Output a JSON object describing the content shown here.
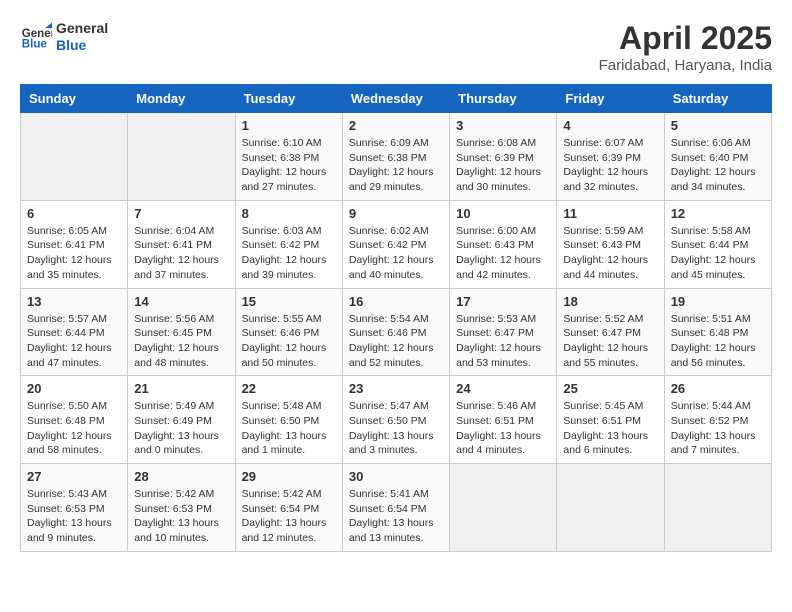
{
  "logo": {
    "line1": "General",
    "line2": "Blue"
  },
  "title": "April 2025",
  "subtitle": "Faridabad, Haryana, India",
  "days_of_week": [
    "Sunday",
    "Monday",
    "Tuesday",
    "Wednesday",
    "Thursday",
    "Friday",
    "Saturday"
  ],
  "weeks": [
    [
      {
        "day": "",
        "info": ""
      },
      {
        "day": "",
        "info": ""
      },
      {
        "day": "1",
        "info": "Sunrise: 6:10 AM\nSunset: 6:38 PM\nDaylight: 12 hours and 27 minutes."
      },
      {
        "day": "2",
        "info": "Sunrise: 6:09 AM\nSunset: 6:38 PM\nDaylight: 12 hours and 29 minutes."
      },
      {
        "day": "3",
        "info": "Sunrise: 6:08 AM\nSunset: 6:39 PM\nDaylight: 12 hours and 30 minutes."
      },
      {
        "day": "4",
        "info": "Sunrise: 6:07 AM\nSunset: 6:39 PM\nDaylight: 12 hours and 32 minutes."
      },
      {
        "day": "5",
        "info": "Sunrise: 6:06 AM\nSunset: 6:40 PM\nDaylight: 12 hours and 34 minutes."
      }
    ],
    [
      {
        "day": "6",
        "info": "Sunrise: 6:05 AM\nSunset: 6:41 PM\nDaylight: 12 hours and 35 minutes."
      },
      {
        "day": "7",
        "info": "Sunrise: 6:04 AM\nSunset: 6:41 PM\nDaylight: 12 hours and 37 minutes."
      },
      {
        "day": "8",
        "info": "Sunrise: 6:03 AM\nSunset: 6:42 PM\nDaylight: 12 hours and 39 minutes."
      },
      {
        "day": "9",
        "info": "Sunrise: 6:02 AM\nSunset: 6:42 PM\nDaylight: 12 hours and 40 minutes."
      },
      {
        "day": "10",
        "info": "Sunrise: 6:00 AM\nSunset: 6:43 PM\nDaylight: 12 hours and 42 minutes."
      },
      {
        "day": "11",
        "info": "Sunrise: 5:59 AM\nSunset: 6:43 PM\nDaylight: 12 hours and 44 minutes."
      },
      {
        "day": "12",
        "info": "Sunrise: 5:58 AM\nSunset: 6:44 PM\nDaylight: 12 hours and 45 minutes."
      }
    ],
    [
      {
        "day": "13",
        "info": "Sunrise: 5:57 AM\nSunset: 6:44 PM\nDaylight: 12 hours and 47 minutes."
      },
      {
        "day": "14",
        "info": "Sunrise: 5:56 AM\nSunset: 6:45 PM\nDaylight: 12 hours and 48 minutes."
      },
      {
        "day": "15",
        "info": "Sunrise: 5:55 AM\nSunset: 6:46 PM\nDaylight: 12 hours and 50 minutes."
      },
      {
        "day": "16",
        "info": "Sunrise: 5:54 AM\nSunset: 6:46 PM\nDaylight: 12 hours and 52 minutes."
      },
      {
        "day": "17",
        "info": "Sunrise: 5:53 AM\nSunset: 6:47 PM\nDaylight: 12 hours and 53 minutes."
      },
      {
        "day": "18",
        "info": "Sunrise: 5:52 AM\nSunset: 6:47 PM\nDaylight: 12 hours and 55 minutes."
      },
      {
        "day": "19",
        "info": "Sunrise: 5:51 AM\nSunset: 6:48 PM\nDaylight: 12 hours and 56 minutes."
      }
    ],
    [
      {
        "day": "20",
        "info": "Sunrise: 5:50 AM\nSunset: 6:48 PM\nDaylight: 12 hours and 58 minutes."
      },
      {
        "day": "21",
        "info": "Sunrise: 5:49 AM\nSunset: 6:49 PM\nDaylight: 13 hours and 0 minutes."
      },
      {
        "day": "22",
        "info": "Sunrise: 5:48 AM\nSunset: 6:50 PM\nDaylight: 13 hours and 1 minute."
      },
      {
        "day": "23",
        "info": "Sunrise: 5:47 AM\nSunset: 6:50 PM\nDaylight: 13 hours and 3 minutes."
      },
      {
        "day": "24",
        "info": "Sunrise: 5:46 AM\nSunset: 6:51 PM\nDaylight: 13 hours and 4 minutes."
      },
      {
        "day": "25",
        "info": "Sunrise: 5:45 AM\nSunset: 6:51 PM\nDaylight: 13 hours and 6 minutes."
      },
      {
        "day": "26",
        "info": "Sunrise: 5:44 AM\nSunset: 6:52 PM\nDaylight: 13 hours and 7 minutes."
      }
    ],
    [
      {
        "day": "27",
        "info": "Sunrise: 5:43 AM\nSunset: 6:53 PM\nDaylight: 13 hours and 9 minutes."
      },
      {
        "day": "28",
        "info": "Sunrise: 5:42 AM\nSunset: 6:53 PM\nDaylight: 13 hours and 10 minutes."
      },
      {
        "day": "29",
        "info": "Sunrise: 5:42 AM\nSunset: 6:54 PM\nDaylight: 13 hours and 12 minutes."
      },
      {
        "day": "30",
        "info": "Sunrise: 5:41 AM\nSunset: 6:54 PM\nDaylight: 13 hours and 13 minutes."
      },
      {
        "day": "",
        "info": ""
      },
      {
        "day": "",
        "info": ""
      },
      {
        "day": "",
        "info": ""
      }
    ]
  ]
}
